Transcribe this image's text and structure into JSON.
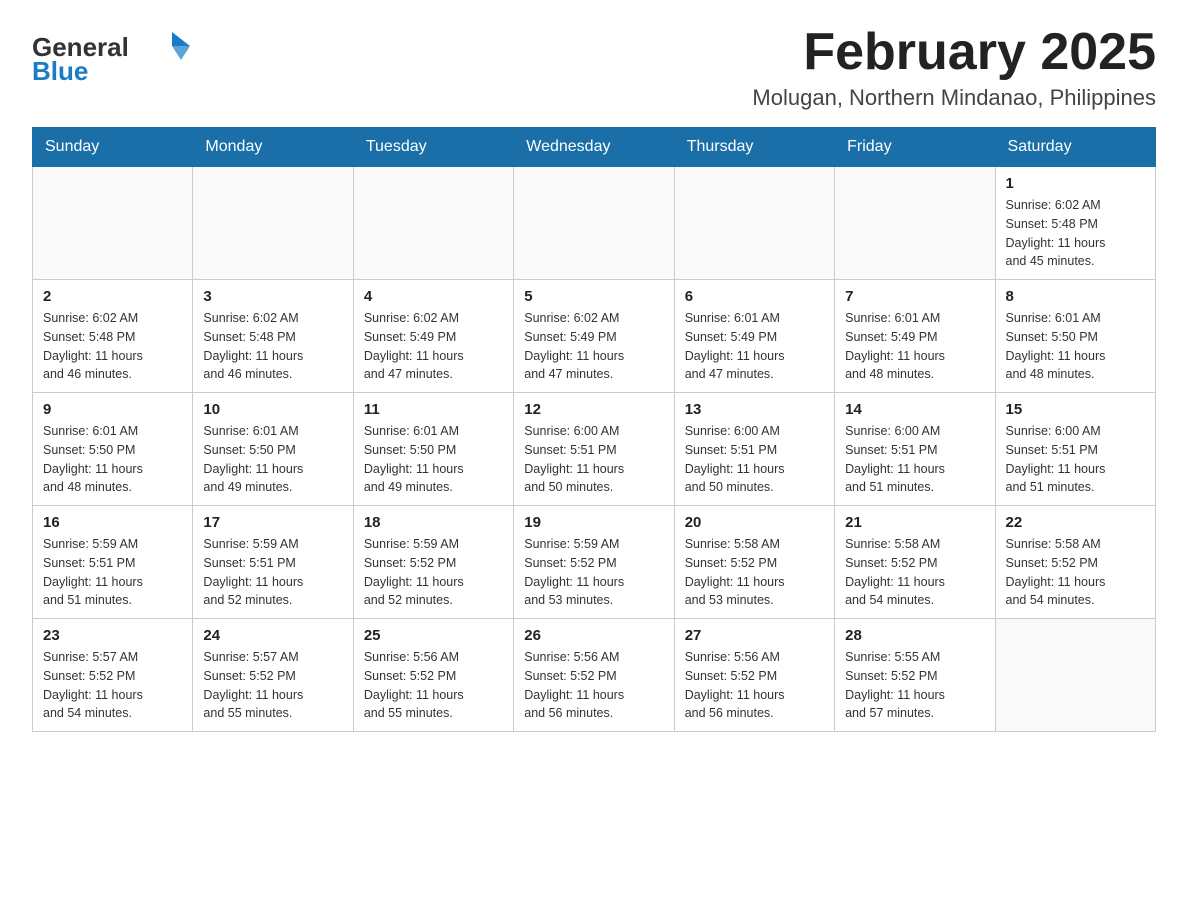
{
  "logo": {
    "general": "General",
    "blue": "Blue"
  },
  "title": {
    "main": "February 2025",
    "sub": "Molugan, Northern Mindanao, Philippines"
  },
  "weekdays": [
    "Sunday",
    "Monday",
    "Tuesday",
    "Wednesday",
    "Thursday",
    "Friday",
    "Saturday"
  ],
  "weeks": [
    [
      {
        "day": "",
        "info": ""
      },
      {
        "day": "",
        "info": ""
      },
      {
        "day": "",
        "info": ""
      },
      {
        "day": "",
        "info": ""
      },
      {
        "day": "",
        "info": ""
      },
      {
        "day": "",
        "info": ""
      },
      {
        "day": "1",
        "info": "Sunrise: 6:02 AM\nSunset: 5:48 PM\nDaylight: 11 hours\nand 45 minutes."
      }
    ],
    [
      {
        "day": "2",
        "info": "Sunrise: 6:02 AM\nSunset: 5:48 PM\nDaylight: 11 hours\nand 46 minutes."
      },
      {
        "day": "3",
        "info": "Sunrise: 6:02 AM\nSunset: 5:48 PM\nDaylight: 11 hours\nand 46 minutes."
      },
      {
        "day": "4",
        "info": "Sunrise: 6:02 AM\nSunset: 5:49 PM\nDaylight: 11 hours\nand 47 minutes."
      },
      {
        "day": "5",
        "info": "Sunrise: 6:02 AM\nSunset: 5:49 PM\nDaylight: 11 hours\nand 47 minutes."
      },
      {
        "day": "6",
        "info": "Sunrise: 6:01 AM\nSunset: 5:49 PM\nDaylight: 11 hours\nand 47 minutes."
      },
      {
        "day": "7",
        "info": "Sunrise: 6:01 AM\nSunset: 5:49 PM\nDaylight: 11 hours\nand 48 minutes."
      },
      {
        "day": "8",
        "info": "Sunrise: 6:01 AM\nSunset: 5:50 PM\nDaylight: 11 hours\nand 48 minutes."
      }
    ],
    [
      {
        "day": "9",
        "info": "Sunrise: 6:01 AM\nSunset: 5:50 PM\nDaylight: 11 hours\nand 48 minutes."
      },
      {
        "day": "10",
        "info": "Sunrise: 6:01 AM\nSunset: 5:50 PM\nDaylight: 11 hours\nand 49 minutes."
      },
      {
        "day": "11",
        "info": "Sunrise: 6:01 AM\nSunset: 5:50 PM\nDaylight: 11 hours\nand 49 minutes."
      },
      {
        "day": "12",
        "info": "Sunrise: 6:00 AM\nSunset: 5:51 PM\nDaylight: 11 hours\nand 50 minutes."
      },
      {
        "day": "13",
        "info": "Sunrise: 6:00 AM\nSunset: 5:51 PM\nDaylight: 11 hours\nand 50 minutes."
      },
      {
        "day": "14",
        "info": "Sunrise: 6:00 AM\nSunset: 5:51 PM\nDaylight: 11 hours\nand 51 minutes."
      },
      {
        "day": "15",
        "info": "Sunrise: 6:00 AM\nSunset: 5:51 PM\nDaylight: 11 hours\nand 51 minutes."
      }
    ],
    [
      {
        "day": "16",
        "info": "Sunrise: 5:59 AM\nSunset: 5:51 PM\nDaylight: 11 hours\nand 51 minutes."
      },
      {
        "day": "17",
        "info": "Sunrise: 5:59 AM\nSunset: 5:51 PM\nDaylight: 11 hours\nand 52 minutes."
      },
      {
        "day": "18",
        "info": "Sunrise: 5:59 AM\nSunset: 5:52 PM\nDaylight: 11 hours\nand 52 minutes."
      },
      {
        "day": "19",
        "info": "Sunrise: 5:59 AM\nSunset: 5:52 PM\nDaylight: 11 hours\nand 53 minutes."
      },
      {
        "day": "20",
        "info": "Sunrise: 5:58 AM\nSunset: 5:52 PM\nDaylight: 11 hours\nand 53 minutes."
      },
      {
        "day": "21",
        "info": "Sunrise: 5:58 AM\nSunset: 5:52 PM\nDaylight: 11 hours\nand 54 minutes."
      },
      {
        "day": "22",
        "info": "Sunrise: 5:58 AM\nSunset: 5:52 PM\nDaylight: 11 hours\nand 54 minutes."
      }
    ],
    [
      {
        "day": "23",
        "info": "Sunrise: 5:57 AM\nSunset: 5:52 PM\nDaylight: 11 hours\nand 54 minutes."
      },
      {
        "day": "24",
        "info": "Sunrise: 5:57 AM\nSunset: 5:52 PM\nDaylight: 11 hours\nand 55 minutes."
      },
      {
        "day": "25",
        "info": "Sunrise: 5:56 AM\nSunset: 5:52 PM\nDaylight: 11 hours\nand 55 minutes."
      },
      {
        "day": "26",
        "info": "Sunrise: 5:56 AM\nSunset: 5:52 PM\nDaylight: 11 hours\nand 56 minutes."
      },
      {
        "day": "27",
        "info": "Sunrise: 5:56 AM\nSunset: 5:52 PM\nDaylight: 11 hours\nand 56 minutes."
      },
      {
        "day": "28",
        "info": "Sunrise: 5:55 AM\nSunset: 5:52 PM\nDaylight: 11 hours\nand 57 minutes."
      },
      {
        "day": "",
        "info": ""
      }
    ]
  ],
  "accent_color": "#1a6fa8"
}
